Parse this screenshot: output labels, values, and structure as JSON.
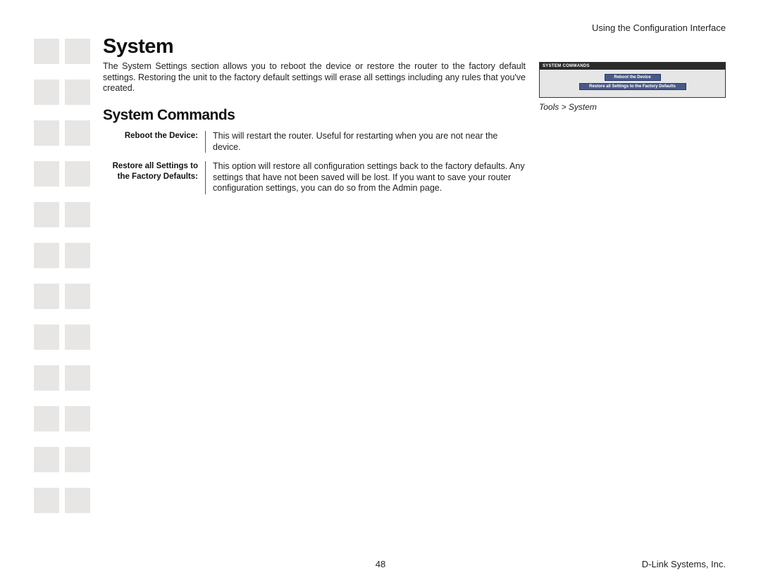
{
  "header": {
    "right_text": "Using the Configuration Interface"
  },
  "main": {
    "title": "System",
    "intro": "The System Settings section allows you to reboot the device or restore the router to the factory default settings. Restoring the unit to the factory default settings will erase all settings including any rules that you've created.",
    "sub_title": "System Commands",
    "defs": [
      {
        "term": "Reboot the Device:",
        "desc": "This will restart the router. Useful for restarting when you are not near the device."
      },
      {
        "term": "Restore all Settings to the Factory Defaults:",
        "desc": "This option will restore all configuration settings back to the factory defaults. Any settings that have not been saved will be lost. If you want to save your router configuration settings, you can do so from the Admin page."
      }
    ]
  },
  "figure": {
    "panel_title": "SYSTEM COMMANDS",
    "btn1": "Reboot the Device",
    "btn2": "Restore all Settings to the Factory Defaults",
    "caption": "Tools > System"
  },
  "footer": {
    "page_number": "48",
    "company": "D-Link Systems, Inc."
  }
}
